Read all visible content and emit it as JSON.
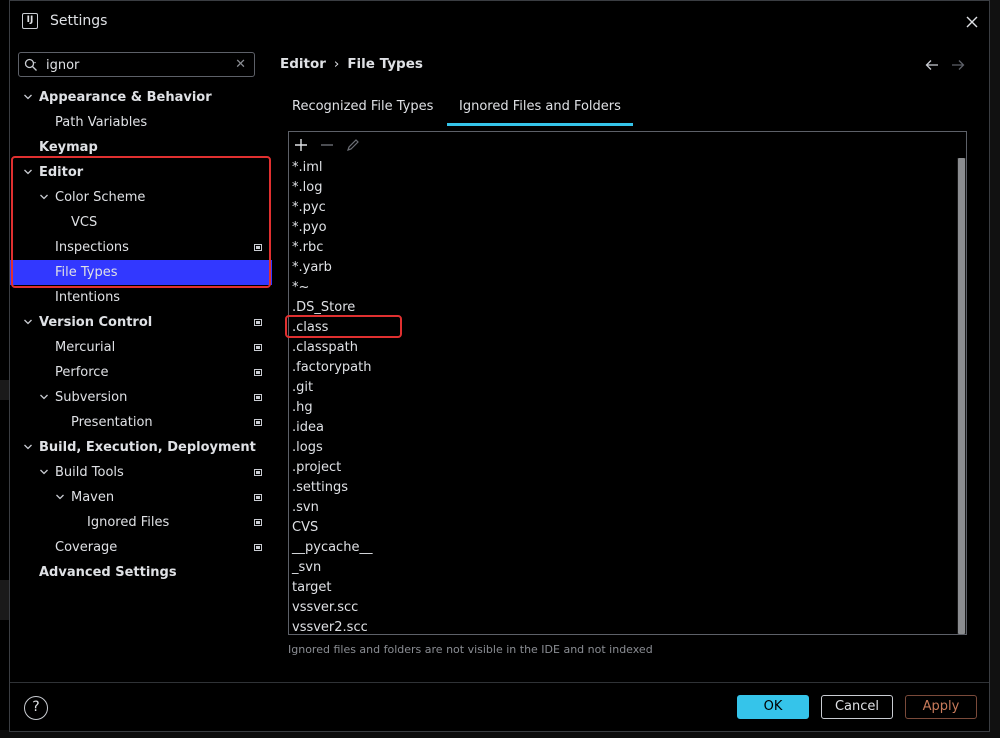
{
  "window": {
    "title": "Settings",
    "logo_text": "IJ"
  },
  "search": {
    "value": "ignor"
  },
  "tree": [
    {
      "label": "Appearance & Behavior",
      "level": 0,
      "bold": true,
      "expanded": true,
      "badge": false
    },
    {
      "label": "Path Variables",
      "level": 1,
      "bold": false,
      "badge": false
    },
    {
      "label": "Keymap",
      "level": 0,
      "bold": true,
      "badge": false
    },
    {
      "label": "Editor",
      "level": 0,
      "bold": true,
      "expanded": true,
      "badge": false
    },
    {
      "label": "Color Scheme",
      "level": 1,
      "bold": false,
      "expanded": true,
      "badge": false
    },
    {
      "label": "VCS",
      "level": 2,
      "bold": false,
      "badge": false
    },
    {
      "label": "Inspections",
      "level": 1,
      "bold": false,
      "badge": true
    },
    {
      "label": "File Types",
      "level": 1,
      "bold": false,
      "badge": false,
      "selected": true
    },
    {
      "label": "Intentions",
      "level": 1,
      "bold": false,
      "badge": false
    },
    {
      "label": "Version Control",
      "level": 0,
      "bold": true,
      "expanded": true,
      "badge": true
    },
    {
      "label": "Mercurial",
      "level": 1,
      "bold": false,
      "badge": true
    },
    {
      "label": "Perforce",
      "level": 1,
      "bold": false,
      "badge": true
    },
    {
      "label": "Subversion",
      "level": 1,
      "bold": false,
      "expanded": true,
      "badge": true
    },
    {
      "label": "Presentation",
      "level": 2,
      "bold": false,
      "badge": true
    },
    {
      "label": "Build, Execution, Deployment",
      "level": 0,
      "bold": true,
      "expanded": true,
      "badge": false
    },
    {
      "label": "Build Tools",
      "level": 1,
      "bold": false,
      "expanded": true,
      "badge": true
    },
    {
      "label": "Maven",
      "level": 2,
      "bold": false,
      "expanded": true,
      "badge": true
    },
    {
      "label": "Ignored Files",
      "level": 3,
      "bold": false,
      "badge": true
    },
    {
      "label": "Coverage",
      "level": 1,
      "bold": false,
      "badge": true
    },
    {
      "label": "Advanced Settings",
      "level": 0,
      "bold": true,
      "badge": false
    }
  ],
  "breadcrumb": {
    "parent": "Editor",
    "separator": "›",
    "current": "File Types"
  },
  "tabs": [
    {
      "label": "Recognized File Types",
      "active": false
    },
    {
      "label": "Ignored Files and Folders",
      "active": true
    }
  ],
  "ignored_list": [
    "*.iml",
    "*.log",
    "*.pyc",
    "*.pyo",
    "*.rbc",
    "*.yarb",
    "*~",
    ".DS_Store",
    ".class",
    ".classpath",
    ".factorypath",
    ".git",
    ".hg",
    ".idea",
    ".logs",
    ".project",
    ".settings",
    ".svn",
    "CVS",
    "__pycache__",
    "_svn",
    "target",
    "vssver.scc",
    "vssver2.scc"
  ],
  "hint": "Ignored files and folders are not visible in the IDE and not indexed",
  "footer": {
    "help": "?",
    "ok": "OK",
    "cancel": "Cancel",
    "apply": "Apply"
  },
  "colors": {
    "accent": "#35c4ea",
    "selection": "#3238ff",
    "highlight_box": "#e03030"
  },
  "icons": [
    "search-icon",
    "close-icon",
    "chevron-down-icon",
    "plus-icon",
    "minus-icon",
    "edit-icon",
    "arrow-left-icon",
    "arrow-right-icon",
    "help-icon"
  ]
}
